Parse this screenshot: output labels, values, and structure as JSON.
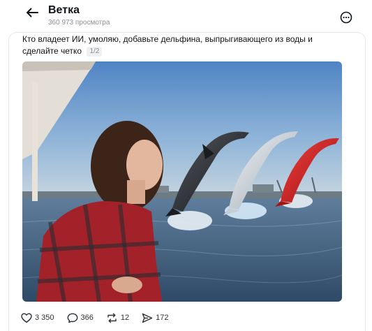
{
  "header": {
    "title": "Ветка",
    "views": "360 973 просмотра"
  },
  "post": {
    "text": "Кто владеет ИИ, умоляю, добавьте дельфина, выпрыгивающего из воды и сделайте четко",
    "pager": "1/2"
  },
  "media": {
    "description_icon": "photo"
  },
  "actions": {
    "likes": "3 350",
    "comments": "366",
    "reposts": "12",
    "shares": "172"
  },
  "icons": {
    "back": "arrow-left-icon",
    "more": "more-icon",
    "like": "heart-icon",
    "comment": "comment-icon",
    "repost": "repost-icon",
    "share": "share-icon"
  }
}
